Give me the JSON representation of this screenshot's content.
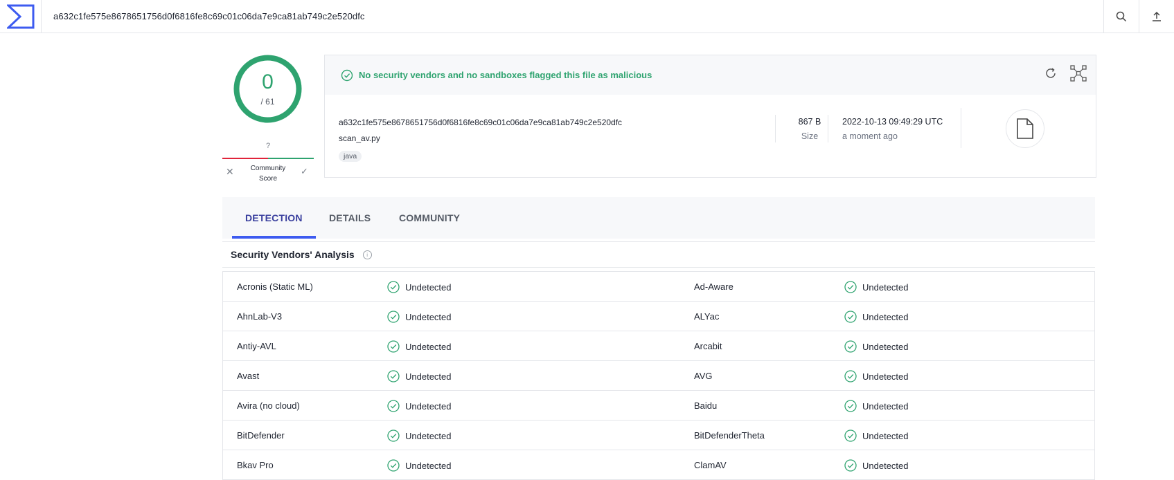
{
  "header": {
    "search_value": "a632c1fe575e8678651756d0f6816fe8c69c01c06da7e9ca81ab749c2e520dfc"
  },
  "score": {
    "detections": "0",
    "total": "/ 61"
  },
  "community": {
    "value": "?",
    "label_line1": "Community",
    "label_line2": "Score"
  },
  "summary": {
    "message": "No security vendors and no sandboxes flagged this file as malicious",
    "hash": "a632c1fe575e8678651756d0f6816fe8c69c01c06da7e9ca81ab749c2e520dfc",
    "filename": "scan_av.py",
    "tag": "java",
    "size_value": "867 B",
    "size_label": "Size",
    "date_value": "2022-10-13 09:49:29 UTC",
    "date_relative": "a moment ago"
  },
  "tabs": [
    {
      "label": "DETECTION",
      "active": true
    },
    {
      "label": "DETAILS",
      "active": false
    },
    {
      "label": "COMMUNITY",
      "active": false
    }
  ],
  "section": {
    "title": "Security Vendors' Analysis"
  },
  "vendors": [
    {
      "left": {
        "name": "Acronis (Static ML)",
        "result": "Undetected"
      },
      "right": {
        "name": "Ad-Aware",
        "result": "Undetected"
      }
    },
    {
      "left": {
        "name": "AhnLab-V3",
        "result": "Undetected"
      },
      "right": {
        "name": "ALYac",
        "result": "Undetected"
      }
    },
    {
      "left": {
        "name": "Antiy-AVL",
        "result": "Undetected"
      },
      "right": {
        "name": "Arcabit",
        "result": "Undetected"
      }
    },
    {
      "left": {
        "name": "Avast",
        "result": "Undetected"
      },
      "right": {
        "name": "AVG",
        "result": "Undetected"
      }
    },
    {
      "left": {
        "name": "Avira (no cloud)",
        "result": "Undetected"
      },
      "right": {
        "name": "Baidu",
        "result": "Undetected"
      }
    },
    {
      "left": {
        "name": "BitDefender",
        "result": "Undetected"
      },
      "right": {
        "name": "BitDefenderTheta",
        "result": "Undetected"
      }
    },
    {
      "left": {
        "name": "Bkav Pro",
        "result": "Undetected"
      },
      "right": {
        "name": "ClamAV",
        "result": "Undetected"
      }
    }
  ],
  "colors": {
    "clean": "#2ea36f",
    "brand": "#3d5bf0",
    "malicious": "#e0243a"
  },
  "icons": {
    "logo": "virustotal-logo-icon",
    "search": "search-icon",
    "upload": "upload-icon",
    "refresh": "refresh-icon",
    "graph": "graph-icon",
    "file": "file-icon",
    "ok": "check-circle-icon"
  }
}
